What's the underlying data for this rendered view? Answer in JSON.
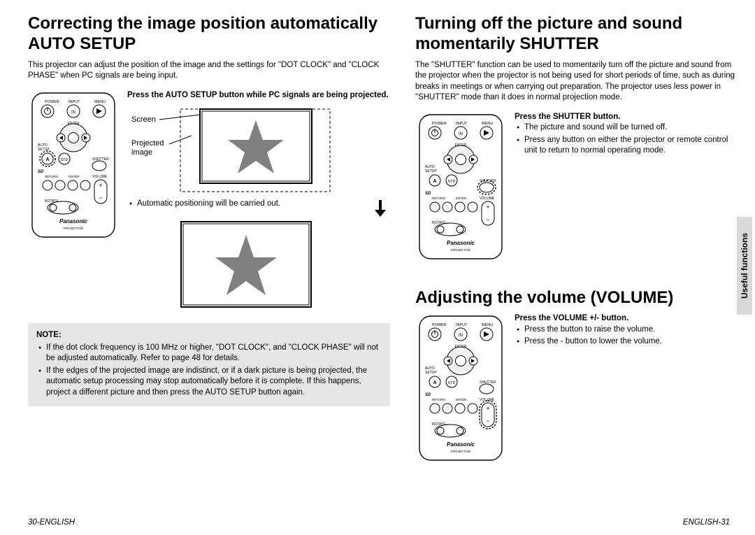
{
  "left": {
    "title": "Correcting the image position automatically AUTO SETUP",
    "intro": "This projector can adjust the position of the image and the settings for \"DOT CLOCK\" and \"CLOCK PHASE\" when PC signals are being input.",
    "step_title": "Press the AUTO SETUP button while PC signals are being projected.",
    "screen_label": "Screen",
    "projected_label": "Projected image",
    "auto_pos": "Automatic positioning will be carried out.",
    "note_heading": "NOTE:",
    "note1": "If the dot clock frequency is 100 MHz or higher, \"DOT CLOCK\", and \"CLOCK PHASE\" will not be adjusted automatically. Refer to page 48 for details.",
    "note2": "If the edges of the projected image are indistinct, or if a dark picture is being projected, the automatic setup processing may stop automatically before it is complete. If this happens, project a different picture and then press the AUTO SETUP button again."
  },
  "right": {
    "shutter_title": "Turning off the picture and sound momentarily SHUTTER",
    "shutter_intro": "The \"SHUTTER\" function can be used to momentarily turn off the picture and sound from the projector when the projector is not being used for short periods of time, such as during breaks in meetings or when carrying out preparation. The projector uses less power in \"SHUTTER\" mode than it does in normal projection mode.",
    "shutter_step": "Press the SHUTTER button.",
    "shutter_b1": "The picture and sound will be turned off.",
    "shutter_b2": "Press any button on either the projector or remote control unit to return to normal operating mode.",
    "volume_title": "Adjusting the volume (VOLUME)",
    "volume_step": "Press the VOLUME +/- button.",
    "volume_b1": "Press the  button to raise the volume.",
    "volume_b2": "Press the - button to lower the volume."
  },
  "side_tab": "Useful functions",
  "footer_left": "30-ENGLISH",
  "footer_right": "ENGLISH-31",
  "remote": {
    "brand": "Panasonic",
    "model": "PROJECTOR",
    "labels": {
      "power": "POWER",
      "input": "INPUT",
      "menu": "MENU",
      "enter_top": "ENTER",
      "auto_setup": "AUTO\nSETUP",
      "a": "A",
      "std": "STD",
      "shutter": "SHUTTER",
      "return": "RETURN",
      "enter_mid": "ENTER",
      "volume": "VOLUME",
      "rotate": "ROTATE",
      "in": "IN",
      "sd": "SD"
    }
  }
}
